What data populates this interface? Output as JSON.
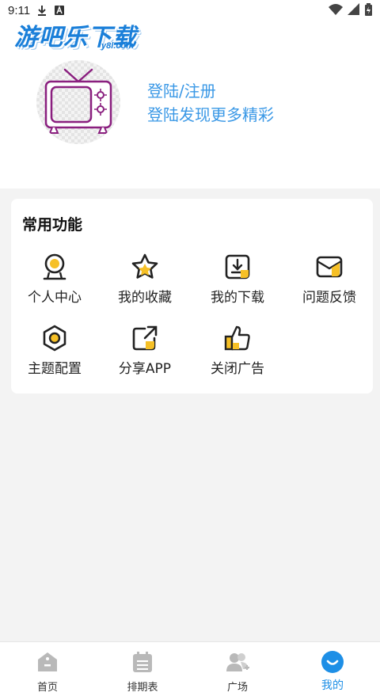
{
  "status_bar": {
    "time": "9:11"
  },
  "brand": {
    "logo_text": "游吧乐下载",
    "logo_sub": "y8l.com"
  },
  "profile": {
    "login_label": "登陆/注册",
    "tagline": "登陆发现更多精彩"
  },
  "functions": {
    "title": "常用功能",
    "items": [
      {
        "label": "个人中心",
        "icon": "user-circle-icon"
      },
      {
        "label": "我的收藏",
        "icon": "star-icon"
      },
      {
        "label": "我的下载",
        "icon": "download-icon"
      },
      {
        "label": "问题反馈",
        "icon": "mail-icon"
      },
      {
        "label": "主题配置",
        "icon": "hexagon-theme-icon"
      },
      {
        "label": "分享APP",
        "icon": "share-icon"
      },
      {
        "label": "关闭广告",
        "icon": "thumbs-up-icon"
      }
    ]
  },
  "bottom_nav": {
    "items": [
      {
        "label": "首页",
        "icon": "home-icon"
      },
      {
        "label": "排期表",
        "icon": "calendar-icon"
      },
      {
        "label": "广场",
        "icon": "users-icon"
      },
      {
        "label": "我的",
        "icon": "profile-smile-icon",
        "active": true
      }
    ]
  },
  "colors": {
    "accent_blue": "#1e8fe6",
    "link_blue": "#3a98e6",
    "icon_yellow": "#f6c026",
    "tv_purple": "#8a1f7f"
  }
}
